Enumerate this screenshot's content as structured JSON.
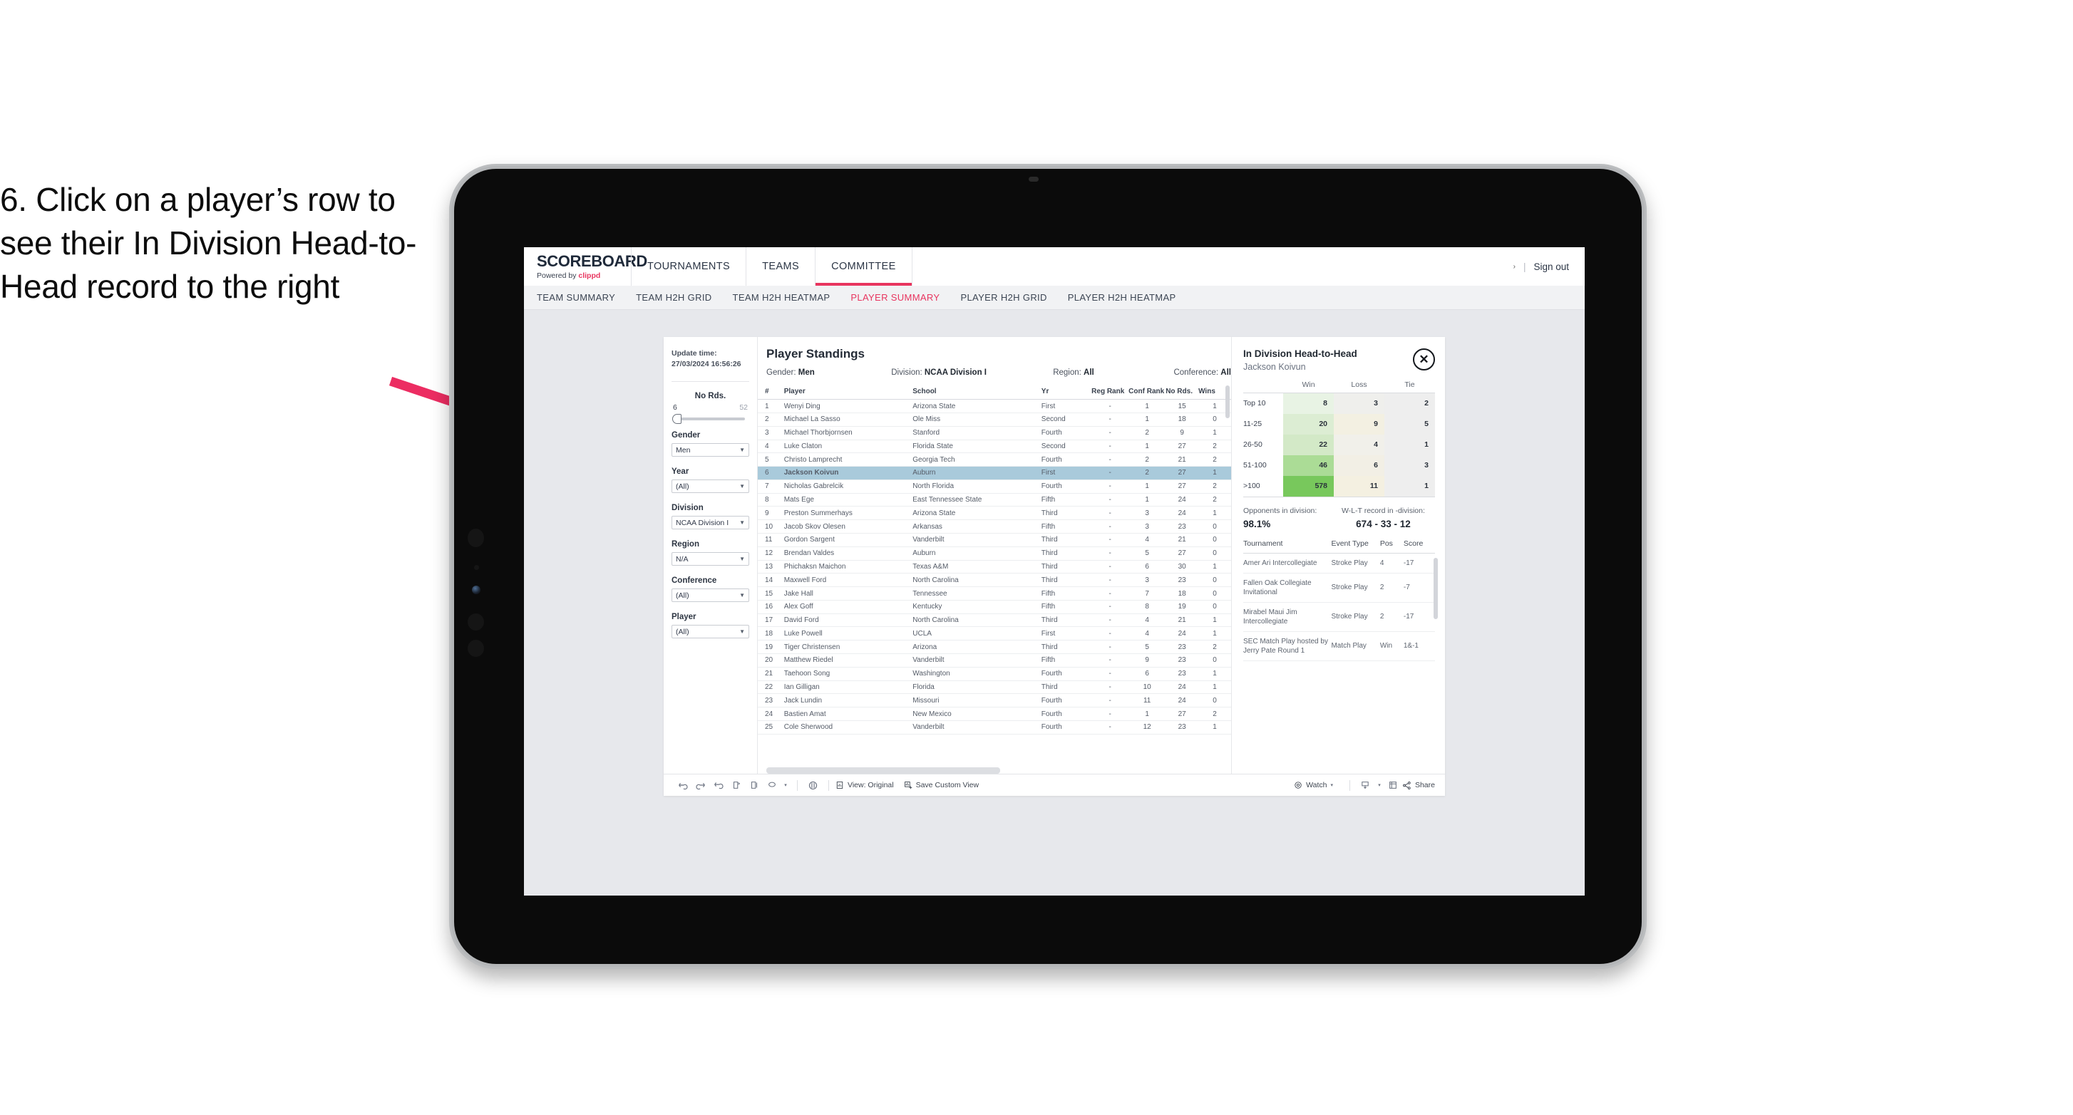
{
  "caption": "6. Click on a player’s row to see their In Division Head-to-Head record to the right",
  "app": {
    "brand": {
      "title": "SCOREBOARD",
      "powered_prefix": "Powered by ",
      "powered_name": "clippd"
    },
    "topnav": [
      {
        "label": "TOURNAMENTS",
        "active": false
      },
      {
        "label": "TEAMS",
        "active": false
      },
      {
        "label": "COMMITTEE",
        "active": true
      }
    ],
    "topright": {
      "caret": "›",
      "separator": "|",
      "signout": "Sign out"
    },
    "subnav": [
      {
        "label": "TEAM SUMMARY",
        "active": false
      },
      {
        "label": "TEAM H2H GRID",
        "active": false
      },
      {
        "label": "TEAM H2H HEATMAP",
        "active": false
      },
      {
        "label": "PLAYER SUMMARY",
        "active": true
      },
      {
        "label": "PLAYER H2H GRID",
        "active": false
      },
      {
        "label": "PLAYER H2H HEATMAP",
        "active": false
      }
    ]
  },
  "sidebar": {
    "update_time_label": "Update time:",
    "update_time_value": "27/03/2024 16:56:26",
    "slider": {
      "label": "No Rds.",
      "min": "6",
      "max": "52"
    },
    "filters": [
      {
        "label": "Gender",
        "value": "Men"
      },
      {
        "label": "Year",
        "value": "(All)"
      },
      {
        "label": "Division",
        "value": "NCAA Division I"
      },
      {
        "label": "Region",
        "value": "N/A"
      },
      {
        "label": "Conference",
        "value": "(All)"
      },
      {
        "label": "Player",
        "value": "(All)"
      }
    ]
  },
  "standings": {
    "title": "Player Standings",
    "filters": [
      {
        "label": "Gender: ",
        "value": "Men"
      },
      {
        "label": "Division: ",
        "value": "NCAA Division I"
      },
      {
        "label": "Region: ",
        "value": "All"
      },
      {
        "label": "Conference: ",
        "value": "All"
      }
    ],
    "columns": [
      "#",
      "Player",
      "School",
      "Yr",
      "Reg Rank",
      "Conf Rank",
      "No Rds.",
      "Wins"
    ],
    "rows": [
      {
        "num": "1",
        "player": "Wenyi Ding",
        "school": "Arizona State",
        "yr": "First",
        "reg": "-",
        "conf": "1",
        "rds": "15",
        "wins": "1",
        "selected": false
      },
      {
        "num": "2",
        "player": "Michael La Sasso",
        "school": "Ole Miss",
        "yr": "Second",
        "reg": "-",
        "conf": "1",
        "rds": "18",
        "wins": "0",
        "selected": false
      },
      {
        "num": "3",
        "player": "Michael Thorbjornsen",
        "school": "Stanford",
        "yr": "Fourth",
        "reg": "-",
        "conf": "2",
        "rds": "9",
        "wins": "1",
        "selected": false
      },
      {
        "num": "4",
        "player": "Luke Claton",
        "school": "Florida State",
        "yr": "Second",
        "reg": "-",
        "conf": "1",
        "rds": "27",
        "wins": "2",
        "selected": false
      },
      {
        "num": "5",
        "player": "Christo Lamprecht",
        "school": "Georgia Tech",
        "yr": "Fourth",
        "reg": "-",
        "conf": "2",
        "rds": "21",
        "wins": "2",
        "selected": false
      },
      {
        "num": "6",
        "player": "Jackson Koivun",
        "school": "Auburn",
        "yr": "First",
        "reg": "-",
        "conf": "2",
        "rds": "27",
        "wins": "1",
        "selected": true
      },
      {
        "num": "7",
        "player": "Nicholas Gabrelcik",
        "school": "North Florida",
        "yr": "Fourth",
        "reg": "-",
        "conf": "1",
        "rds": "27",
        "wins": "2",
        "selected": false
      },
      {
        "num": "8",
        "player": "Mats Ege",
        "school": "East Tennessee State",
        "yr": "Fifth",
        "reg": "-",
        "conf": "1",
        "rds": "24",
        "wins": "2",
        "selected": false
      },
      {
        "num": "9",
        "player": "Preston Summerhays",
        "school": "Arizona State",
        "yr": "Third",
        "reg": "-",
        "conf": "3",
        "rds": "24",
        "wins": "1",
        "selected": false
      },
      {
        "num": "10",
        "player": "Jacob Skov Olesen",
        "school": "Arkansas",
        "yr": "Fifth",
        "reg": "-",
        "conf": "3",
        "rds": "23",
        "wins": "0",
        "selected": false
      },
      {
        "num": "11",
        "player": "Gordon Sargent",
        "school": "Vanderbilt",
        "yr": "Third",
        "reg": "-",
        "conf": "4",
        "rds": "21",
        "wins": "0",
        "selected": false
      },
      {
        "num": "12",
        "player": "Brendan Valdes",
        "school": "Auburn",
        "yr": "Third",
        "reg": "-",
        "conf": "5",
        "rds": "27",
        "wins": "0",
        "selected": false
      },
      {
        "num": "13",
        "player": "Phichaksn Maichon",
        "school": "Texas A&M",
        "yr": "Third",
        "reg": "-",
        "conf": "6",
        "rds": "30",
        "wins": "1",
        "selected": false
      },
      {
        "num": "14",
        "player": "Maxwell Ford",
        "school": "North Carolina",
        "yr": "Third",
        "reg": "-",
        "conf": "3",
        "rds": "23",
        "wins": "0",
        "selected": false
      },
      {
        "num": "15",
        "player": "Jake Hall",
        "school": "Tennessee",
        "yr": "Fifth",
        "reg": "-",
        "conf": "7",
        "rds": "18",
        "wins": "0",
        "selected": false
      },
      {
        "num": "16",
        "player": "Alex Goff",
        "school": "Kentucky",
        "yr": "Fifth",
        "reg": "-",
        "conf": "8",
        "rds": "19",
        "wins": "0",
        "selected": false
      },
      {
        "num": "17",
        "player": "David Ford",
        "school": "North Carolina",
        "yr": "Third",
        "reg": "-",
        "conf": "4",
        "rds": "21",
        "wins": "1",
        "selected": false
      },
      {
        "num": "18",
        "player": "Luke Powell",
        "school": "UCLA",
        "yr": "First",
        "reg": "-",
        "conf": "4",
        "rds": "24",
        "wins": "1",
        "selected": false
      },
      {
        "num": "19",
        "player": "Tiger Christensen",
        "school": "Arizona",
        "yr": "Third",
        "reg": "-",
        "conf": "5",
        "rds": "23",
        "wins": "2",
        "selected": false
      },
      {
        "num": "20",
        "player": "Matthew Riedel",
        "school": "Vanderbilt",
        "yr": "Fifth",
        "reg": "-",
        "conf": "9",
        "rds": "23",
        "wins": "0",
        "selected": false
      },
      {
        "num": "21",
        "player": "Taehoon Song",
        "school": "Washington",
        "yr": "Fourth",
        "reg": "-",
        "conf": "6",
        "rds": "23",
        "wins": "1",
        "selected": false
      },
      {
        "num": "22",
        "player": "Ian Gilligan",
        "school": "Florida",
        "yr": "Third",
        "reg": "-",
        "conf": "10",
        "rds": "24",
        "wins": "1",
        "selected": false
      },
      {
        "num": "23",
        "player": "Jack Lundin",
        "school": "Missouri",
        "yr": "Fourth",
        "reg": "-",
        "conf": "11",
        "rds": "24",
        "wins": "0",
        "selected": false
      },
      {
        "num": "24",
        "player": "Bastien Amat",
        "school": "New Mexico",
        "yr": "Fourth",
        "reg": "-",
        "conf": "1",
        "rds": "27",
        "wins": "2",
        "selected": false
      },
      {
        "num": "25",
        "player": "Cole Sherwood",
        "school": "Vanderbilt",
        "yr": "Fourth",
        "reg": "-",
        "conf": "12",
        "rds": "23",
        "wins": "1",
        "selected": false
      }
    ]
  },
  "detail": {
    "title": "In Division Head-to-Head",
    "subtitle": "Jackson Koivun",
    "close_glyph": "✕",
    "h2h_columns": [
      "Win",
      "Loss",
      "Tie"
    ],
    "h2h_rows": [
      {
        "bucket": "Top 10",
        "win": "8",
        "loss": "3",
        "tie": "2",
        "win_color": "#e8f3e4",
        "loss_color": "#efefec",
        "tie_color": "#eeeeee"
      },
      {
        "bucket": "11-25",
        "win": "20",
        "loss": "9",
        "tie": "5",
        "win_color": "#dcedd3",
        "loss_color": "#f3f0e2",
        "tie_color": "#eeeeee"
      },
      {
        "bucket": "26-50",
        "win": "22",
        "loss": "4",
        "tie": "1",
        "win_color": "#d3e9c7",
        "loss_color": "#f1f0ea",
        "tie_color": "#eeeeee"
      },
      {
        "bucket": "51-100",
        "win": "46",
        "loss": "6",
        "tie": "3",
        "win_color": "#abdc96",
        "loss_color": "#f2efe5",
        "tie_color": "#eeeeee"
      },
      {
        "bucket": ">100",
        "win": "578",
        "loss": "11",
        "tie": "1",
        "win_color": "#78c85c",
        "loss_color": "#f4f0e1",
        "tie_color": "#eeeeee"
      }
    ],
    "opponents_label": "Opponents in division:",
    "opponents_value": "98.1%",
    "wlt_label": "W-L-T record in -division:",
    "wlt_value": "674 - 33 - 12",
    "trn_columns": [
      "Tournament",
      "Event Type",
      "Pos",
      "Score"
    ],
    "trn_rows": [
      {
        "name": "Amer Ari Intercollegiate",
        "type": "Stroke Play",
        "pos": "4",
        "score": "-17"
      },
      {
        "name": "Fallen Oak Collegiate Invitational",
        "type": "Stroke Play",
        "pos": "2",
        "score": "-7"
      },
      {
        "name": "Mirabel Maui Jim Intercollegiate",
        "type": "Stroke Play",
        "pos": "2",
        "score": "-17"
      },
      {
        "name": "SEC Match Play hosted by Jerry Pate Round 1",
        "type": "Match Play",
        "pos": "Win",
        "score": "1&-1"
      }
    ]
  },
  "toolbar": {
    "view_label": "View: Original",
    "save_label": "Save Custom View",
    "watch_label": "Watch",
    "share_label": "Share",
    "caret": "▾"
  },
  "colors": {
    "accent": "#e8355f",
    "selected_row": "#a9cadb",
    "arrow": "#ec2d62"
  }
}
